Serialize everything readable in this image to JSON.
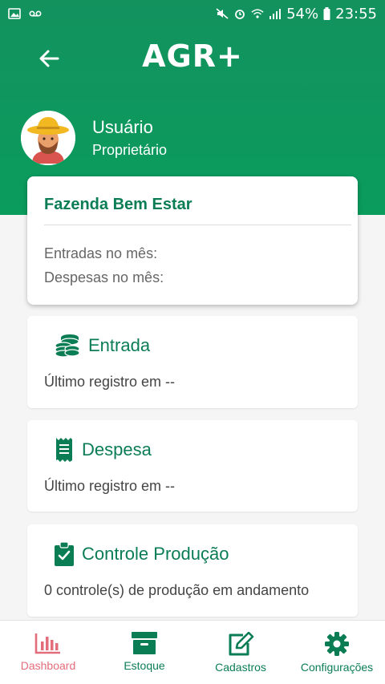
{
  "status_bar": {
    "battery": "54%",
    "time": "23:55"
  },
  "header": {
    "logo": "AGR+"
  },
  "profile": {
    "name": "Usuário",
    "role": "Proprietário"
  },
  "farm": {
    "name": "Fazenda Bem Estar",
    "income_label": "Entradas no mês:",
    "expense_label": "Despesas no mês:"
  },
  "cards": {
    "entrada": {
      "title": "Entrada",
      "detail": "Último registro em --"
    },
    "despesa": {
      "title": "Despesa",
      "detail": "Último registro em --"
    },
    "producao": {
      "title": "Controle Produção",
      "detail": "0 controle(s) de produção em andamento"
    }
  },
  "bottom_nav": [
    {
      "label": "Dashboard",
      "icon": "bar-chart-icon",
      "active": true
    },
    {
      "label": "Estoque",
      "icon": "archive-box-icon"
    },
    {
      "label": "Cadastros",
      "icon": "edit-icon"
    },
    {
      "label": "Configurações",
      "icon": "gear-icon"
    }
  ],
  "colors": {
    "primary": "#0b7d55",
    "header": "#13925e",
    "active": "#e36d7a"
  }
}
